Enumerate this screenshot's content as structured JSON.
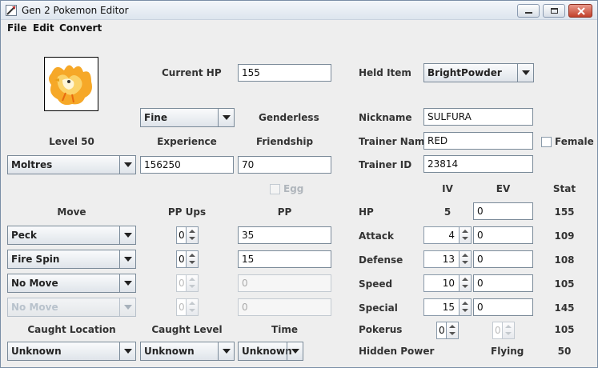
{
  "window": {
    "title": "Gen 2 Pokemon Editor"
  },
  "menu": {
    "file": "File",
    "edit": "Edit",
    "convert": "Convert"
  },
  "labels": {
    "current_hp": "Current HP",
    "held_item": "Held Item",
    "genderless": "Genderless",
    "nickname": "Nickname",
    "level": "Level 50",
    "experience": "Experience",
    "friendship": "Friendship",
    "trainer_name": "Trainer Name",
    "female": "Female",
    "trainer_id": "Trainer ID",
    "egg": "Egg",
    "iv": "IV",
    "ev": "EV",
    "stat": "Stat",
    "move": "Move",
    "pp_ups": "PP Ups",
    "pp": "PP",
    "caught_location": "Caught Location",
    "caught_level": "Caught Level",
    "time": "Time",
    "pokerus": "Pokerus",
    "hidden_power": "Hidden Power"
  },
  "values": {
    "current_hp": "155",
    "held_item": "BrightPowder",
    "status": "Fine",
    "nickname": "SULFURA",
    "species": "Moltres",
    "experience": "156250",
    "friendship": "70",
    "trainer_name": "RED",
    "trainer_id": "23814",
    "caught_location": "Unknown",
    "caught_level": "Unknown",
    "time": "Unknown",
    "pokerus": "0",
    "pokerus_2": "0",
    "pokerus_stat": "105",
    "hidden_power_type": "Flying",
    "hidden_power_power": "50"
  },
  "moves": [
    {
      "name": "Peck",
      "pp_ups": "0",
      "pp": "35"
    },
    {
      "name": "Fire Spin",
      "pp_ups": "0",
      "pp": "15"
    },
    {
      "name": "No Move",
      "pp_ups": "0",
      "pp": "0"
    },
    {
      "name": "No Move",
      "pp_ups": "0",
      "pp": "0"
    }
  ],
  "stats": [
    {
      "name": "HP",
      "iv": "5",
      "ev": "0",
      "stat": "155"
    },
    {
      "name": "Attack",
      "iv": "4",
      "ev": "0",
      "stat": "109"
    },
    {
      "name": "Defense",
      "iv": "13",
      "ev": "0",
      "stat": "108"
    },
    {
      "name": "Speed",
      "iv": "10",
      "ev": "0",
      "stat": "105"
    },
    {
      "name": "Special",
      "iv": "15",
      "ev": "0",
      "stat": "145"
    }
  ],
  "icons": {
    "sprite": "moltres-sprite",
    "app": "app-icon"
  }
}
